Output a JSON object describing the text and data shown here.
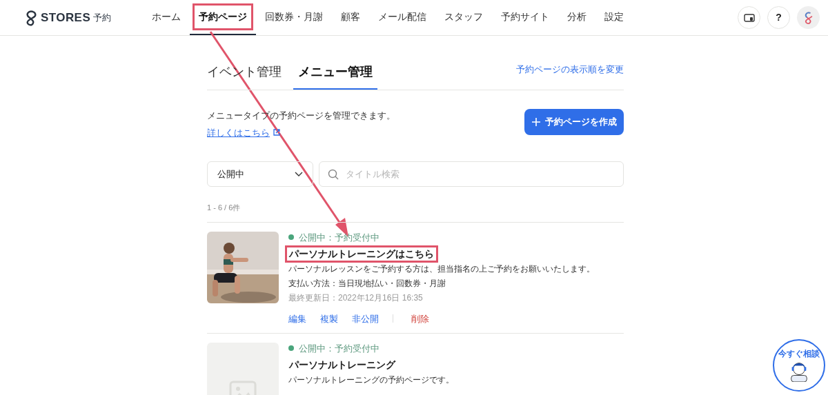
{
  "header": {
    "logo": {
      "brand": "STORES",
      "product": "予約"
    },
    "nav": [
      {
        "label": "ホーム",
        "selected": false,
        "highlighted": false
      },
      {
        "label": "予約ページ",
        "selected": true,
        "highlighted": true
      },
      {
        "label": "回数券・月謝",
        "selected": false,
        "highlighted": false
      },
      {
        "label": "顧客",
        "selected": false,
        "highlighted": false
      },
      {
        "label": "メール配信",
        "selected": false,
        "highlighted": false
      },
      {
        "label": "スタッフ",
        "selected": false,
        "highlighted": false
      },
      {
        "label": "予約サイト",
        "selected": false,
        "highlighted": false
      },
      {
        "label": "分析",
        "selected": false,
        "highlighted": false
      },
      {
        "label": "設定",
        "selected": false,
        "highlighted": false
      }
    ],
    "help_label": "?"
  },
  "tabs": [
    {
      "label": "イベント管理",
      "selected": false
    },
    {
      "label": "メニュー管理",
      "selected": true
    }
  ],
  "reorder_link": "予約ページの表示順を変更",
  "intro": {
    "text": "メニュータイプの予約ページを管理できます。",
    "link": "詳しくはこちら"
  },
  "create_button": "予約ページを作成",
  "filter": {
    "value": "公開中"
  },
  "search": {
    "placeholder": "タイトル検索"
  },
  "count": "1 - 6 / 6件",
  "items": [
    {
      "status": "公開中：予約受付中",
      "title": "パーソナルトレーニングはこちら",
      "highlighted": true,
      "description": "パーソナルレッスンをご予約する方は、担当指名の上ご予約をお願いいたします。",
      "payment": "支払い方法：当日現地払い・回数券・月謝",
      "updated": "最終更新日：2022年12月16日 16:35",
      "actions": [
        {
          "label": "編集",
          "kind": "link"
        },
        {
          "label": "複製",
          "kind": "link"
        },
        {
          "label": "非公開",
          "kind": "link"
        },
        {
          "label": "削除",
          "kind": "danger"
        }
      ]
    },
    {
      "kind": "placeholder",
      "status": "公開中：予約受付中",
      "title": "パーソナルトレーニング",
      "highlighted": false,
      "description": "パーソナルトレーニングの予約ページです。"
    }
  ],
  "chat_widget": {
    "label": "今すぐ相談"
  }
}
